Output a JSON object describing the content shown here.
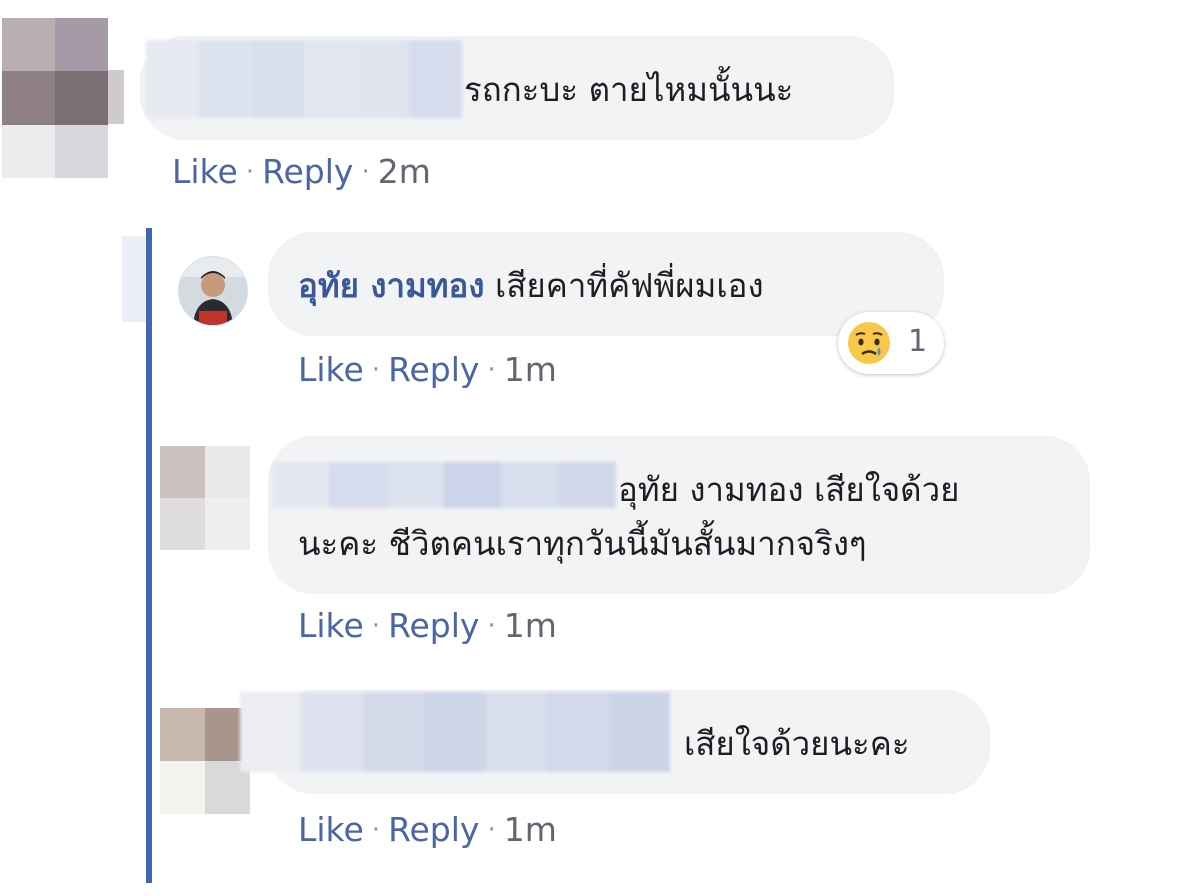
{
  "comments": [
    {
      "text": "รถกะบะ ตายไหมนั้นนะ",
      "actions": {
        "like": "Like",
        "reply": "Reply",
        "time": "2m"
      }
    }
  ],
  "replies": [
    {
      "author": "อุทัย งามทอง",
      "text": "เสียคาที่คัฟพี่ผมเอง",
      "reaction": {
        "icon": "sad-face-icon",
        "count": "1"
      },
      "actions": {
        "like": "Like",
        "reply": "Reply",
        "time": "1m"
      }
    },
    {
      "text_line1": "อุทัย งามทอง เสียใจด้วย",
      "text_line2": "นะคะ ชีวิตคนเราทุกวันนี้มันสั้นมากจริงๆ",
      "actions": {
        "like": "Like",
        "reply": "Reply",
        "time": "1m"
      }
    },
    {
      "text": "เสียใจด้วยนะคะ",
      "actions": {
        "like": "Like",
        "reply": "Reply",
        "time": "1m"
      }
    }
  ],
  "ui": {
    "separator": "·",
    "link_color": "#4b67a1",
    "author_color": "#385898",
    "thread_line_color": "#4267b2",
    "bubble_color": "#f2f3f5"
  }
}
